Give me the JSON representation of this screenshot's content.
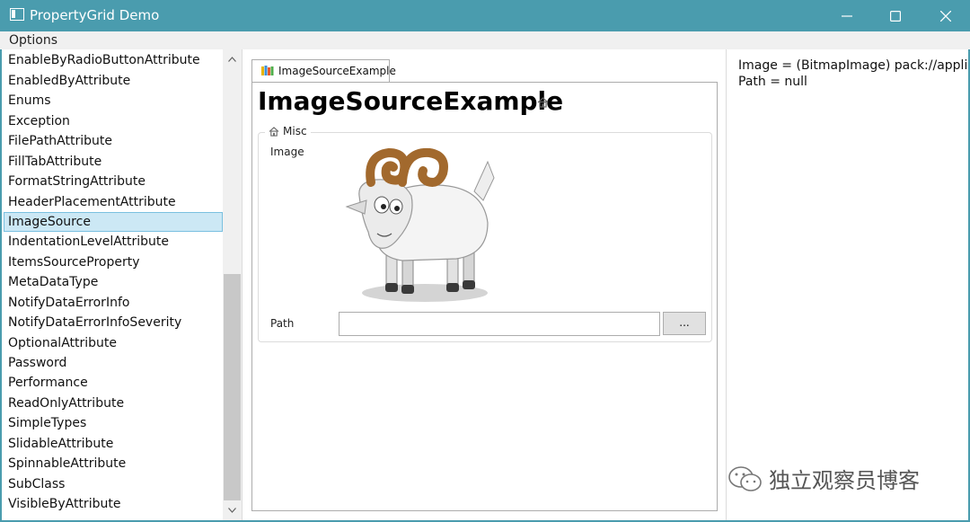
{
  "window": {
    "title": "PropertyGrid Demo",
    "minimize_icon": "minimize-icon",
    "maximize_icon": "maximize-icon",
    "close_icon": "close-icon"
  },
  "menu": {
    "options": "Options"
  },
  "list": {
    "items": [
      "EnableByRadioButtonAttribute",
      "EnabledByAttribute",
      "Enums",
      "Exception",
      "FilePathAttribute",
      "FillTabAttribute",
      "FormatStringAttribute",
      "HeaderPlacementAttribute",
      "ImageSource",
      "IndentationLevelAttribute",
      "ItemsSourceProperty",
      "MetaDataType",
      "NotifyDataErrorInfo",
      "NotifyDataErrorInfoSeverity",
      "OptionalAttribute",
      "Password",
      "Performance",
      "ReadOnlyAttribute",
      "SimpleTypes",
      "SlidableAttribute",
      "SpinnableAttribute",
      "SubClass",
      "VisibleByAttribute"
    ],
    "selected": "ImageSource"
  },
  "editor": {
    "tab_label": "ImageSourceExample",
    "heading": "ImageSourceExample",
    "group_label": "Misc",
    "image_label": "Image",
    "path_label": "Path",
    "path_value": "",
    "browse_label": "..."
  },
  "output": {
    "lines": [
      "Image = (BitmapImage) pack://application",
      "Path = null"
    ]
  },
  "watermark": {
    "text": "独立观察员博客"
  },
  "colors": {
    "titlebar": "#4a9cae",
    "selection": "#cce8f5",
    "selection_border": "#7ac0e0"
  }
}
